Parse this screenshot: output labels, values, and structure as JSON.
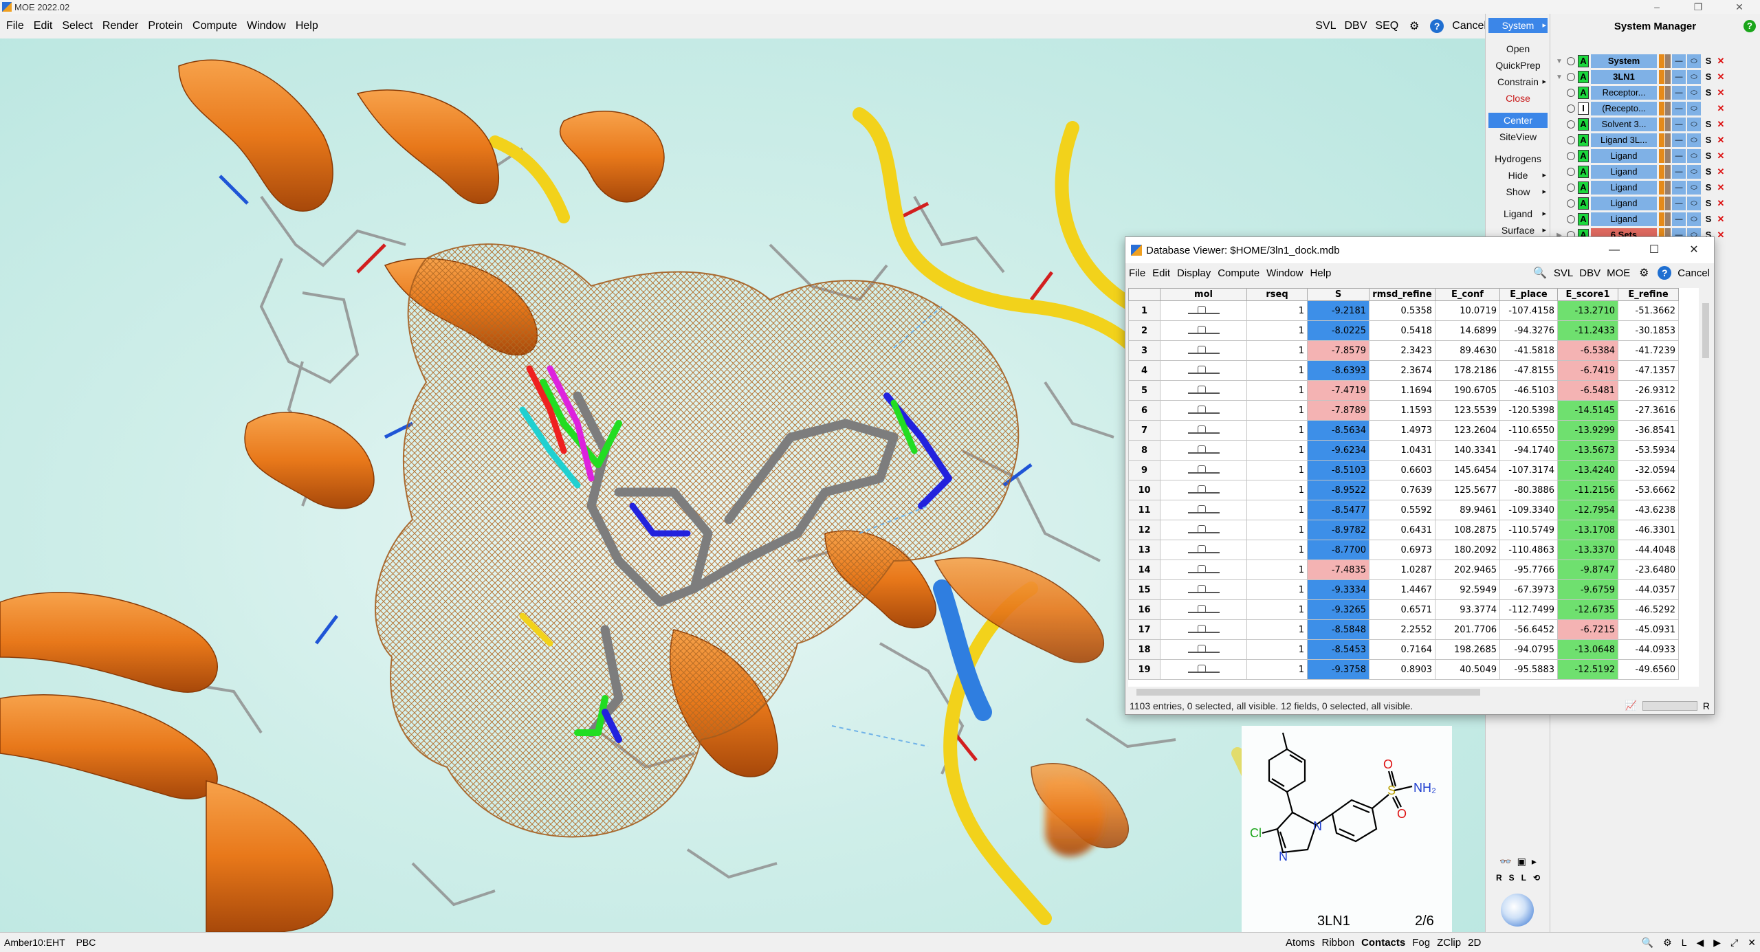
{
  "app": {
    "title": "MOE 2022.02"
  },
  "menubar": {
    "items": [
      "File",
      "Edit",
      "Select",
      "Render",
      "Protein",
      "Compute",
      "Window",
      "Help"
    ],
    "right": {
      "svl": "SVL",
      "dbv": "DBV",
      "seq": "SEQ",
      "cancel": "Cancel"
    }
  },
  "commands": {
    "system": "System",
    "open": "Open",
    "quickprep": "QuickPrep",
    "constrain": "Constrain",
    "close": "Close",
    "center": "Center",
    "siteview": "SiteView",
    "hydrogens": "Hydrogens",
    "hide": "Hide",
    "show": "Show",
    "ligand": "Ligand",
    "surface": "Surface"
  },
  "system_manager": {
    "title": "System Manager",
    "rows": [
      {
        "name": "System",
        "aa": "A",
        "s": "S"
      },
      {
        "name": "3LN1",
        "aa": "A",
        "s": "S"
      },
      {
        "name": "Receptor...",
        "aa": "A",
        "s": "S"
      },
      {
        "name": "(Recepto...",
        "aa": "I",
        "s": ""
      },
      {
        "name": "Solvent 3...",
        "aa": "A",
        "s": "S"
      },
      {
        "name": "Ligand 3L...",
        "aa": "A",
        "s": "S"
      },
      {
        "name": "Ligand",
        "aa": "A",
        "s": "S"
      },
      {
        "name": "Ligand",
        "aa": "A",
        "s": "S"
      },
      {
        "name": "Ligand",
        "aa": "A",
        "s": "S"
      },
      {
        "name": "Ligand",
        "aa": "A",
        "s": "S"
      },
      {
        "name": "Ligand",
        "aa": "A",
        "s": "S"
      },
      {
        "name": "6 Sets",
        "aa": "A",
        "s": "S"
      }
    ]
  },
  "db_viewer": {
    "title": "Database Viewer: $HOME/3ln1_dock.mdb",
    "menu": [
      "File",
      "Edit",
      "Display",
      "Compute",
      "Window",
      "Help"
    ],
    "right": {
      "svl": "SVL",
      "dbv": "DBV",
      "moe": "MOE",
      "cancel": "Cancel"
    },
    "columns": [
      "mol",
      "rseq",
      "S",
      "rmsd_refine",
      "E_conf",
      "E_place",
      "E_score1",
      "E_refine"
    ],
    "rows": [
      [
        "1",
        "1",
        "-9.2181",
        "0.5358",
        "10.0719",
        "-107.4158",
        "-13.2710",
        "-51.3662"
      ],
      [
        "2",
        "1",
        "-8.0225",
        "0.5418",
        "14.6899",
        "-94.3276",
        "-11.2433",
        "-30.1853"
      ],
      [
        "3",
        "1",
        "-7.8579",
        "2.3423",
        "89.4630",
        "-41.5818",
        "-6.5384",
        "-41.7239"
      ],
      [
        "4",
        "1",
        "-8.6393",
        "2.3674",
        "178.2186",
        "-47.8155",
        "-6.7419",
        "-47.1357"
      ],
      [
        "5",
        "1",
        "-7.4719",
        "1.1694",
        "190.6705",
        "-46.5103",
        "-6.5481",
        "-26.9312"
      ],
      [
        "6",
        "1",
        "-7.8789",
        "1.1593",
        "123.5539",
        "-120.5398",
        "-14.5145",
        "-27.3616"
      ],
      [
        "7",
        "1",
        "-8.5634",
        "1.4973",
        "123.2604",
        "-110.6550",
        "-13.9299",
        "-36.8541"
      ],
      [
        "8",
        "1",
        "-9.6234",
        "1.0431",
        "140.3341",
        "-94.1740",
        "-13.5673",
        "-53.5934"
      ],
      [
        "9",
        "1",
        "-8.5103",
        "0.6603",
        "145.6454",
        "-107.3174",
        "-13.4240",
        "-32.0594"
      ],
      [
        "10",
        "1",
        "-8.9522",
        "0.7639",
        "125.5677",
        "-80.3886",
        "-11.2156",
        "-53.6662"
      ],
      [
        "11",
        "1",
        "-8.5477",
        "0.5592",
        "89.9461",
        "-109.3340",
        "-12.7954",
        "-43.6238"
      ],
      [
        "12",
        "1",
        "-8.9782",
        "0.6431",
        "108.2875",
        "-110.5749",
        "-13.1708",
        "-46.3301"
      ],
      [
        "13",
        "1",
        "-8.7700",
        "0.6973",
        "180.2092",
        "-110.4863",
        "-13.3370",
        "-44.4048"
      ],
      [
        "14",
        "1",
        "-7.4835",
        "1.0287",
        "202.9465",
        "-95.7766",
        "-9.8747",
        "-23.6480"
      ],
      [
        "15",
        "1",
        "-9.3334",
        "1.4467",
        "92.5949",
        "-67.3973",
        "-9.6759",
        "-44.0357"
      ],
      [
        "16",
        "1",
        "-9.3265",
        "0.6571",
        "93.3774",
        "-112.7499",
        "-12.6735",
        "-46.5292"
      ],
      [
        "17",
        "1",
        "-8.5848",
        "2.2552",
        "201.7706",
        "-56.6452",
        "-6.7215",
        "-45.0931"
      ],
      [
        "18",
        "1",
        "-8.5453",
        "0.7164",
        "198.2685",
        "-94.0795",
        "-13.0648",
        "-44.0933"
      ],
      [
        "19",
        "1",
        "-9.3758",
        "0.8903",
        "40.5049",
        "-95.5883",
        "-12.5192",
        "-49.6560"
      ]
    ],
    "s_colors": [
      "#3d8fe8",
      "#3d8fe8",
      "#f4b3b3",
      "#3d8fe8",
      "#f4b3b3",
      "#f4b3b3",
      "#3d8fe8",
      "#3d8fe8",
      "#3d8fe8",
      "#3d8fe8",
      "#3d8fe8",
      "#3d8fe8",
      "#3d8fe8",
      "#f4b3b3",
      "#3d8fe8",
      "#3d8fe8",
      "#3d8fe8",
      "#3d8fe8",
      "#3d8fe8"
    ],
    "e1_colors": [
      "#6fe06f",
      "#6fe06f",
      "#f4b3b3",
      "#f4b3b3",
      "#f4b3b3",
      "#6fe06f",
      "#6fe06f",
      "#6fe06f",
      "#6fe06f",
      "#6fe06f",
      "#6fe06f",
      "#6fe06f",
      "#6fe06f",
      "#6fe06f",
      "#6fe06f",
      "#6fe06f",
      "#f4b3b3",
      "#6fe06f",
      "#6fe06f"
    ],
    "status": "1103 entries, 0 selected, all visible. 12 fields, 0 selected, all visible."
  },
  "structure": {
    "cl": "Cl",
    "n1": "N",
    "n2": "N",
    "nh2": "NH₂",
    "o1": "O",
    "o2": "O",
    "s": "S",
    "name": "3LN1",
    "page": "2/6"
  },
  "statusbar": {
    "left": [
      "Amber10:EHT",
      "PBC"
    ],
    "toggles": [
      "Atoms",
      "Ribbon",
      "Contacts",
      "Fog",
      "ZClip",
      "2D"
    ],
    "active_toggle": "Contacts"
  },
  "colors": {
    "accent": "#3b86e8",
    "helix": "#e8781a",
    "strand": "#f2d21b"
  }
}
